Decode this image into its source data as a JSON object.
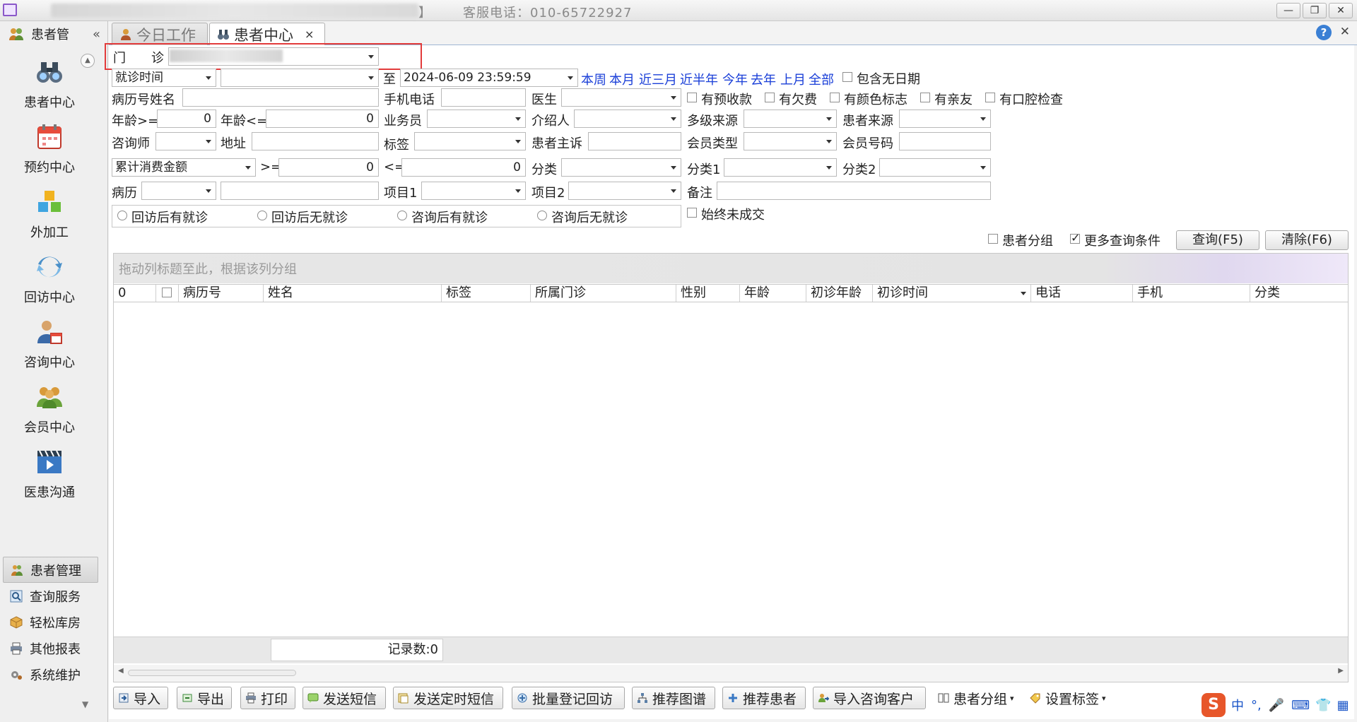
{
  "window": {
    "title": "客服电话：010-65722927",
    "bracket": "】"
  },
  "sidebar": {
    "header": "患者管",
    "collapse": "«",
    "nav": [
      {
        "label": "患者中心",
        "icon": "binoculars-icon"
      },
      {
        "label": "预约中心",
        "icon": "calendar-icon"
      },
      {
        "label": "外加工",
        "icon": "cubes-icon"
      },
      {
        "label": "回访中心",
        "icon": "refresh-icon"
      },
      {
        "label": "咨询中心",
        "icon": "consult-icon"
      },
      {
        "label": "会员中心",
        "icon": "members-icon"
      },
      {
        "label": "医患沟通",
        "icon": "video-icon"
      }
    ],
    "bottom": [
      {
        "label": "患者管理",
        "icon": "users-icon"
      },
      {
        "label": "查询服务",
        "icon": "search-icon"
      },
      {
        "label": "轻松库房",
        "icon": "box-icon"
      },
      {
        "label": "其他报表",
        "icon": "printer-icon"
      },
      {
        "label": "系统维护",
        "icon": "gear-icon"
      }
    ]
  },
  "tabs": [
    {
      "label": "今日工作"
    },
    {
      "label": "患者中心",
      "close": "×"
    }
  ],
  "filters": {
    "clinic_label": "门",
    "clinic_label2": "诊",
    "date_type": "就诊时间",
    "to_label": "至",
    "date_to": "2024-06-09 23:59:59",
    "quick_ranges": [
      "本周",
      "本月",
      "近三月",
      "近半年",
      "今年",
      "去年",
      "上月",
      "全部"
    ],
    "include_no_date": "包含无日期",
    "record_name": "病历号姓名",
    "mobile": "手机电话",
    "doctor": "医生",
    "flags": [
      "有预收款",
      "有欠费",
      "有颜色标志",
      "有亲友",
      "有口腔检查"
    ],
    "age_gte": "年龄>=",
    "age_gte_val": "0",
    "age_lte": "年龄<=",
    "age_lte_val": "0",
    "salesman": "业务员",
    "referrer": "介绍人",
    "multi_source": "多级来源",
    "patient_source": "患者来源",
    "consultant": "咨询师",
    "address": "地址",
    "tag": "标签",
    "complaint": "患者主诉",
    "member_type": "会员类型",
    "member_no": "会员号码",
    "amount_type": "累计消费金额",
    "gte": ">=",
    "gte_val": "0",
    "lte": "<=",
    "lte_val": "0",
    "category": "分类",
    "category1": "分类1",
    "category2": "分类2",
    "record": "病历",
    "item1": "项目1",
    "item2": "项目2",
    "remark": "备注",
    "radios": [
      "回访后有就诊",
      "回访后无就诊",
      "咨询后有就诊",
      "咨询后无就诊"
    ],
    "never_deal": "始终未成交",
    "patient_group": "患者分组",
    "more_conditions": "更多查询条件",
    "query_btn": "查询(F5)",
    "clear_btn": "清除(F6)"
  },
  "grid": {
    "group_hint": "拖动列标题至此，根据该列分组",
    "columns": [
      "0",
      "",
      "病历号",
      "姓名",
      "标签",
      "所属门诊",
      "性别",
      "年龄",
      "初诊年龄",
      "初诊时间",
      "电话",
      "手机",
      "分类"
    ],
    "record_count": "记录数:0"
  },
  "toolbar": [
    {
      "label": "导入",
      "icon": "import-icon"
    },
    {
      "label": "导出",
      "icon": "export-icon"
    },
    {
      "label": "打印",
      "icon": "print-icon"
    },
    {
      "label": "发送短信",
      "icon": "sms-icon"
    },
    {
      "label": "发送定时短信",
      "icon": "timed-sms-icon"
    },
    {
      "label": "批量登记回访",
      "icon": "batch-visit-icon"
    },
    {
      "label": "推荐图谱",
      "icon": "tree-icon"
    },
    {
      "label": "推荐患者",
      "icon": "recommend-icon"
    },
    {
      "label": "导入咨询客户",
      "icon": "import-client-icon"
    },
    {
      "label": "患者分组",
      "icon": "group-icon"
    },
    {
      "label": "设置标签",
      "icon": "tag-icon"
    }
  ],
  "ime": {
    "logo": "S",
    "mode": "中"
  }
}
